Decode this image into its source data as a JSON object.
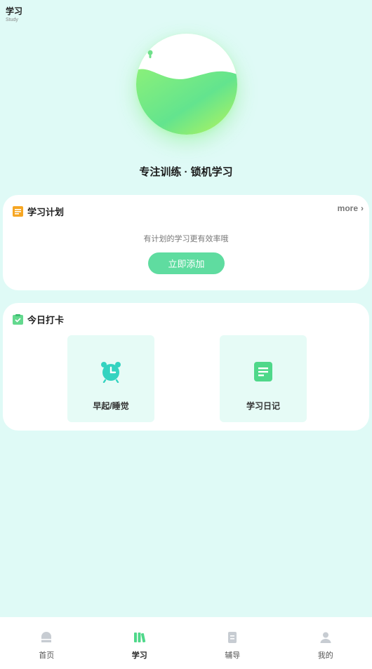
{
  "header": {
    "title": "学习",
    "subtitle": "Study"
  },
  "focus": {
    "title": "专注训练 · 锁机学习",
    "icon": "lock-icon"
  },
  "plan_card": {
    "title": "学习计划",
    "icon": "orange-notepad-icon",
    "more_label": "more",
    "hint": "有计划的学习更有效率哦",
    "add_button": "立即添加"
  },
  "checkin_card": {
    "title": "今日打卡",
    "icon": "green-clipboard-check-icon",
    "tiles": [
      {
        "label": "早起/睡觉",
        "icon": "alarm-clock-icon"
      },
      {
        "label": "学习日记",
        "icon": "diary-note-icon"
      }
    ]
  },
  "tabbar": {
    "items": [
      {
        "label": "首页",
        "icon": "home-icon",
        "active": false
      },
      {
        "label": "学习",
        "icon": "books-icon",
        "active": true
      },
      {
        "label": "辅导",
        "icon": "tutoring-icon",
        "active": false
      },
      {
        "label": "我的",
        "icon": "profile-icon",
        "active": false
      }
    ]
  },
  "colors": {
    "background": "#dffaf6",
    "accent": "#5fdca0",
    "card": "#ffffff",
    "tile": "#e6fbf6"
  }
}
